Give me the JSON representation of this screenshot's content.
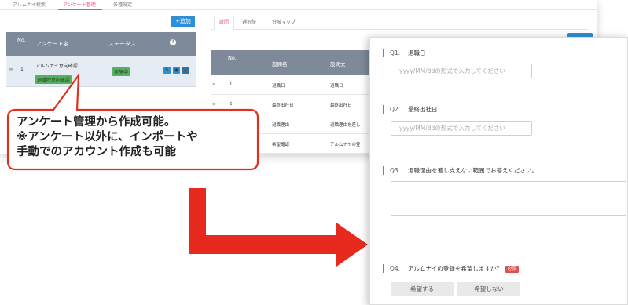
{
  "top_tabs": [
    "アルムナイ検索",
    "アンケート管理",
    "各種設定"
  ],
  "add_button": "+追加",
  "survey_list": {
    "headers": {
      "no": "No.",
      "name": "アンケート名",
      "status": "ステータス",
      "help": "?"
    },
    "row": {
      "handle": "≡",
      "no": "1",
      "name": "アルムナイ意向確認",
      "tag": "退職時意向確認",
      "status": "実施中",
      "icons": [
        "pencil-icon",
        "eye-icon",
        "minus-icon"
      ]
    }
  },
  "sub_tabs": [
    "設問",
    "選択肢",
    "分岐マップ"
  ],
  "question_table": {
    "headers": {
      "no": "No.",
      "name": "設問名",
      "text": "設問文"
    },
    "rows": [
      {
        "handle": "≡",
        "no": "1",
        "name": "退職日",
        "text": "退職日"
      },
      {
        "handle": "≡",
        "no": "2",
        "name": "最終出社日",
        "text": "最終出社日"
      },
      {
        "handle": "",
        "no": "",
        "name": "退職理由",
        "text": "退職理由を差し"
      },
      {
        "handle": "",
        "no": "",
        "name": "希望確認",
        "text": "アルムナイの登"
      }
    ]
  },
  "callout": {
    "lines": [
      "アンケート管理から作成可能。",
      "※アンケート以外に、インポートや",
      "手動でのアカウント作成も可能"
    ],
    "border_color": "#e0301e"
  },
  "arrow_color": "#e82a1e",
  "form": {
    "q1": {
      "num": "Q1.",
      "label": "退職日",
      "placeholder": "yyyy/MM/ddの形式で入力してください"
    },
    "q2": {
      "num": "Q2.",
      "label": "最終出社日",
      "placeholder": "yyyy/MM/ddの形式で入力してください"
    },
    "q3": {
      "num": "Q3.",
      "label": "退職理由を差し支えない範囲でお答えください。"
    },
    "q4": {
      "num": "Q4.",
      "label": "アルムナイの登録を希望しますか？",
      "required": "必須",
      "options": [
        "希望する",
        "希望しない"
      ]
    }
  },
  "colors": {
    "accent_pink": "#e0507a",
    "primary_blue": "#2f8fd6",
    "header_gray": "#7e8a99",
    "status_green": "#51b35a"
  }
}
